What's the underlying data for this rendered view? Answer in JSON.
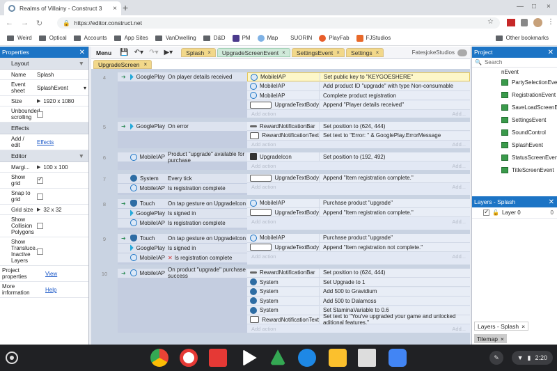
{
  "browser": {
    "tab_title": "Realms of Villainy - Construct 3",
    "url": "https://editor.construct.net",
    "bookmarks": [
      "Weird",
      "Optical",
      "Accounts",
      "App Sites",
      "VanDwelling",
      "D&D",
      "PM",
      "Map",
      "SUORIN",
      "PlayFab",
      "FJStudios"
    ],
    "other_bookmarks": "Other bookmarks"
  },
  "properties": {
    "title": "Properties",
    "layout_section": "Layout",
    "rows": [
      {
        "key": "Name",
        "value": "Splash"
      },
      {
        "key": "Event sheet",
        "value": "SplashEvent"
      },
      {
        "key": "Size",
        "value": "1920 x 1080"
      },
      {
        "key": "Unbounded scrolling",
        "value": ""
      }
    ],
    "effects_section": "Effects",
    "effects_row": {
      "key": "Add / edit",
      "value": "Effects"
    },
    "editor_section": "Editor",
    "editor_rows": [
      {
        "key": "Margi...",
        "value": "100 x 100"
      },
      {
        "key": "Show grid",
        "value": ""
      },
      {
        "key": "Snap to grid",
        "value": ""
      },
      {
        "key": "Grid size",
        "value": "32 x 32"
      },
      {
        "key": "Show Collision Polygons",
        "value": ""
      },
      {
        "key": "Show Transluce... Inactive Layers",
        "value": ""
      }
    ],
    "project_props": {
      "key": "Project properties",
      "value": "View"
    },
    "more_info": {
      "key": "More information",
      "value": "Help"
    }
  },
  "editor": {
    "menu": "Menu",
    "tabs": [
      "Splash",
      "UpgradeScreenEvent",
      "SettingsEvent",
      "Settings"
    ],
    "account": "FatesjokeStudios",
    "subtab": "UpgradeScreen",
    "add_action": "Add action",
    "add_short": "Add...",
    "events": [
      {
        "num": "4",
        "conditions": [
          {
            "obj": "GooglePlay",
            "text": "On player details received",
            "icon": "gp",
            "trigger": true
          }
        ],
        "actions": [
          {
            "obj": "MobileIAP",
            "text": "Set public key to \"KEYGOESHERE\"",
            "icon": "iap",
            "hi": true
          },
          {
            "obj": "MobileIAP",
            "text": "Add product ID \"upgrade\" with type Non-consumable",
            "icon": "iap"
          },
          {
            "obj": "MobileIAP",
            "text": "Complete product registration",
            "icon": "iap"
          },
          {
            "obj": "UpgradeTextBody",
            "text": "Append \"Player details received\"",
            "icon": "txt"
          }
        ]
      },
      {
        "num": "5",
        "conditions": [
          {
            "obj": "GooglePlay",
            "text": "On error",
            "icon": "gp",
            "trigger": true
          }
        ],
        "actions": [
          {
            "obj": "RewardNotificationBar",
            "text": "Set position to (624, 444)",
            "icon": "bar"
          },
          {
            "obj": "RewardNotificationText",
            "text": "Set text to \"Error: \" & GooglePlay.ErrorMessage",
            "icon": "txt"
          }
        ]
      },
      {
        "num": "6",
        "conditions": [
          {
            "obj": "MobileIAP",
            "text": "Product \"upgrade\" available for purchase",
            "icon": "iap"
          }
        ],
        "actions": [
          {
            "obj": "UpgradeIcon",
            "text": "Set position to (192, 492)",
            "icon": "img"
          }
        ]
      },
      {
        "num": "7",
        "conditions": [
          {
            "obj": "System",
            "text": "Every tick",
            "icon": "sys"
          },
          {
            "obj": "MobileIAP",
            "text": "Is registration complete",
            "icon": "iap"
          }
        ],
        "actions": [
          {
            "obj": "UpgradeTextBody",
            "text": "Append \"Item registration complete.\"",
            "icon": "txt"
          }
        ]
      },
      {
        "num": "8",
        "conditions": [
          {
            "obj": "Touch",
            "text": "On tap gesture on UpgradeIcon",
            "icon": "touch",
            "trigger": true
          },
          {
            "obj": "GooglePlay",
            "text": "Is signed in",
            "icon": "gp"
          },
          {
            "obj": "MobileIAP",
            "text": "Is registration complete",
            "icon": "iap"
          }
        ],
        "actions": [
          {
            "obj": "MobileIAP",
            "text": "Purchase product \"upgrade\"",
            "icon": "iap"
          },
          {
            "obj": "UpgradeTextBody",
            "text": "Append \"Item registration complete.\"",
            "icon": "txt"
          }
        ]
      },
      {
        "num": "9",
        "conditions": [
          {
            "obj": "Touch",
            "text": "On tap gesture on UpgradeIcon",
            "icon": "touch",
            "trigger": true
          },
          {
            "obj": "GooglePlay",
            "text": "Is signed in",
            "icon": "gp"
          },
          {
            "obj": "MobileIAP",
            "text": "Is registration complete",
            "icon": "iap",
            "invert": true
          }
        ],
        "actions": [
          {
            "obj": "MobileIAP",
            "text": "Purchase product \"upgrade\"",
            "icon": "iap"
          },
          {
            "obj": "UpgradeTextBody",
            "text": "Append \"Item registration not complete.\"",
            "icon": "txt"
          }
        ]
      },
      {
        "num": "10",
        "conditions": [
          {
            "obj": "MobileIAP",
            "text": "On product \"upgrade\" purchase success",
            "icon": "iap",
            "trigger": true
          }
        ],
        "actions": [
          {
            "obj": "RewardNotificationBar",
            "text": "Set position to (624, 444)",
            "icon": "bar"
          },
          {
            "obj": "System",
            "text": "Set Upgrade to 1",
            "icon": "sys"
          },
          {
            "obj": "System",
            "text": "Add 500 to Gravidium",
            "icon": "sys"
          },
          {
            "obj": "System",
            "text": "Add 500 to Dalamoss",
            "icon": "sys"
          },
          {
            "obj": "System",
            "text": "Set StaminaVariable to 0.6",
            "icon": "sys"
          },
          {
            "obj": "RewardNotificationText",
            "text": "Set text to \"You've upgraded your game and unlocked aditional features.\"",
            "icon": "txt"
          }
        ]
      }
    ]
  },
  "project": {
    "title": "Project",
    "search_placeholder": "Search",
    "items": [
      "nEvent",
      "PartySelectionEvent",
      "RegistrationEvent",
      "SaveLoadScreenEvent",
      "SettingsEvent",
      "SoundControl",
      "SplashEvent",
      "StatusScreenEvent",
      "TitleScreenEvent"
    ]
  },
  "layers": {
    "title": "Layers - Splash",
    "layer_name": "Layer 0",
    "layer_count": "0",
    "bottom_tab": "Layers - Splash",
    "tilemap_tab": "Tilemap"
  },
  "shelf": {
    "time": "2:20"
  },
  "colors": {
    "accent": "#1c74c5",
    "tab_yellow": "#f2d88a",
    "tab_green": "#cfe9d9",
    "event_bg": "#c9d3e2"
  }
}
